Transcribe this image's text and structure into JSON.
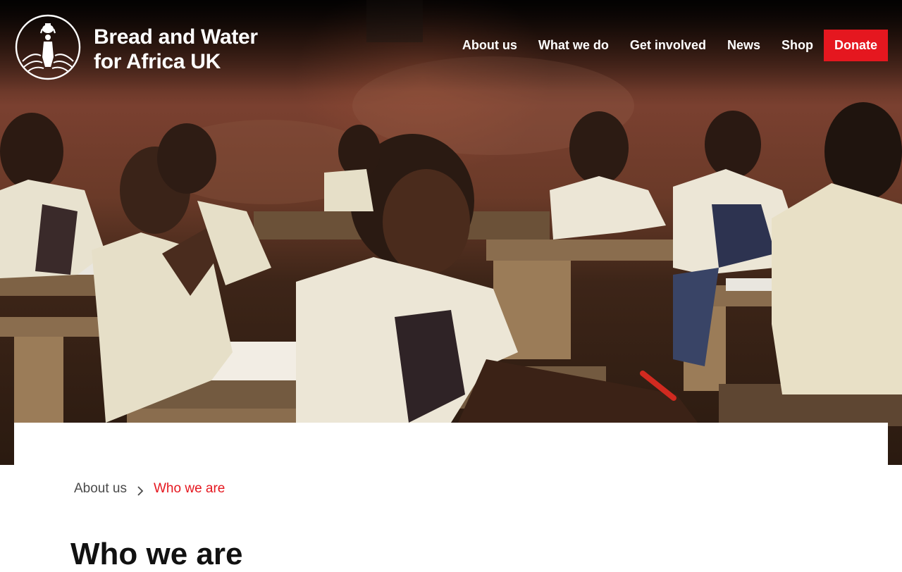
{
  "site": {
    "name_line1": "Bread and Water",
    "name_line2": "for Africa UK",
    "logo_icon": "woman-carrying-water-pot-logo"
  },
  "nav": {
    "items": [
      {
        "label": "About us"
      },
      {
        "label": "What we do"
      },
      {
        "label": "Get involved"
      },
      {
        "label": "News"
      },
      {
        "label": "Shop"
      }
    ],
    "donate_label": "Donate"
  },
  "hero": {
    "image": "photo-classroom-students-at-wooden-desks"
  },
  "breadcrumb": {
    "parent": "About us",
    "current": "Who we are",
    "separator_icon": "chevron-right-icon"
  },
  "page": {
    "title": "Who we are"
  },
  "colors": {
    "accent": "#e5171f",
    "text_dark": "#111111",
    "text_muted": "#4a4a4a"
  }
}
